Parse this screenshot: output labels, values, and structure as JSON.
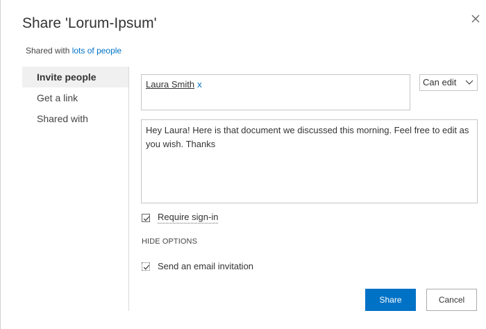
{
  "dialog": {
    "title": "Share 'Lorum-Ipsum'",
    "close_icon": "close-icon"
  },
  "shared_with": {
    "prefix": "Shared with",
    "link": "lots of people"
  },
  "nav": {
    "items": [
      {
        "label": "Invite people",
        "active": true
      },
      {
        "label": "Get a link",
        "active": false
      },
      {
        "label": "Shared with",
        "active": false
      }
    ]
  },
  "invite": {
    "person_name": "Laura Smith",
    "remove_label": "x",
    "permission": "Can edit",
    "message": "Hey Laura! Here is that document we discussed this morning. Feel free to edit as you wish. Thanks",
    "require_signin_label": "Require sign-in",
    "require_signin_checked": true,
    "hide_options_label": "HIDE OPTIONS",
    "send_email_label": "Send an email invitation",
    "send_email_checked": true
  },
  "buttons": {
    "share": "Share",
    "cancel": "Cancel"
  },
  "colors": {
    "accent": "#0072c6",
    "nav_active_bg": "#f0f0f0",
    "border": "#c6c6c6"
  }
}
